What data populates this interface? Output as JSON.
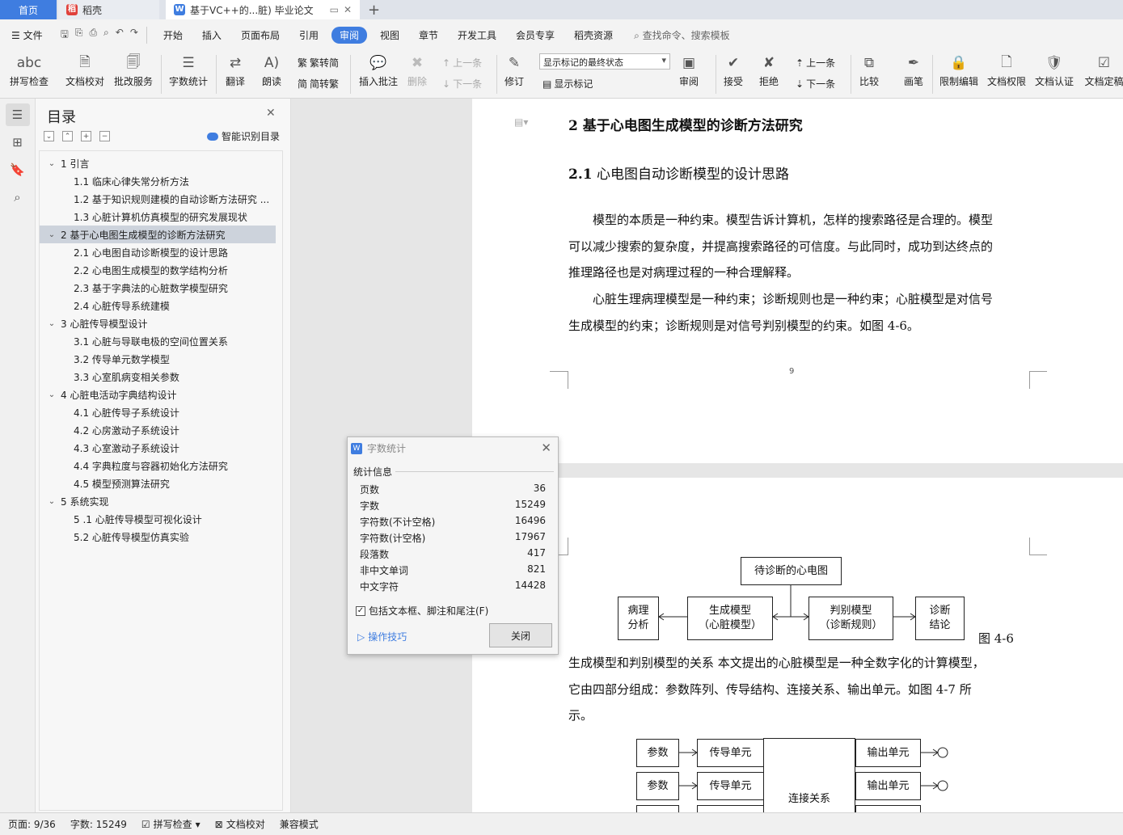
{
  "tabs": {
    "home": "首页",
    "docer": "稻壳",
    "document": "基于VC++的...脏) 毕业论文",
    "new_tab": "+"
  },
  "menu": {
    "file": "文件",
    "items": [
      "开始",
      "插入",
      "页面布局",
      "引用",
      "审阅",
      "视图",
      "章节",
      "开发工具",
      "会员专享",
      "稻壳资源"
    ],
    "active": "审阅",
    "search": "查找命令、搜索模板"
  },
  "ribbon": {
    "spellcheck": "拼写检查",
    "doc_proof": "文档校对",
    "proof_service": "批改服务",
    "word_count": "字数统计",
    "translate": "翻译",
    "read_aloud": "朗读",
    "to_simplified": "繁转简",
    "to_traditional": "简转繁",
    "insert_comment": "插入批注",
    "delete": "删除",
    "prev_comment": "上一条",
    "next_comment": "下一条",
    "revise": "修订",
    "markup_mode": "显示标记的最终状态",
    "show_markup": "显示标记",
    "review": "审阅",
    "accept": "接受",
    "reject": "拒绝",
    "prev_change": "上一条",
    "next_change": "下一条",
    "compare": "比较",
    "pen": "画笔",
    "restrict_edit": "限制编辑",
    "doc_permission": "文档权限",
    "doc_certify": "文档认证",
    "doc_finalize": "文档定稿"
  },
  "toc": {
    "title": "目录",
    "smart": "智能识别目录",
    "items": [
      {
        "level": 1,
        "text": "1 引言"
      },
      {
        "level": 2,
        "text": "1.1 临床心律失常分析方法"
      },
      {
        "level": 2,
        "text": "1.2 基于知识规则建模的自动诊断方法研究 ..."
      },
      {
        "level": 2,
        "text": "1.3 心脏计算机仿真模型的研究发展现状"
      },
      {
        "level": 1,
        "text": "2 基于心电图生成模型的诊断方法研究",
        "selected": true
      },
      {
        "level": 2,
        "text": "2.1 心电图自动诊断模型的设计思路"
      },
      {
        "level": 2,
        "text": "2.2 心电图生成模型的数学结构分析"
      },
      {
        "level": 2,
        "text": "2.3 基于字典法的心脏数学模型研究"
      },
      {
        "level": 2,
        "text": "2.4 心脏传导系统建模"
      },
      {
        "level": 1,
        "text": "3 心脏传导模型设计"
      },
      {
        "level": 2,
        "text": "3.1 心脏与导联电极的空间位置关系"
      },
      {
        "level": 2,
        "text": "3.2 传导单元数学模型"
      },
      {
        "level": 2,
        "text": "3.3 心室肌病变相关参数"
      },
      {
        "level": 1,
        "text": "4 心脏电活动字典结构设计"
      },
      {
        "level": 2,
        "text": "4.1 心脏传导子系统设计"
      },
      {
        "level": 2,
        "text": "4.2 心房激动子系统设计"
      },
      {
        "level": 2,
        "text": "4.3 心室激动子系统设计"
      },
      {
        "level": 2,
        "text": "4.4 字典粒度与容器初始化方法研究"
      },
      {
        "level": 2,
        "text": "4.5 模型预测算法研究"
      },
      {
        "level": 1,
        "text": "5 系统实现"
      },
      {
        "level": 2,
        "text": "5 .1 心脏传导模型可视化设计"
      },
      {
        "level": 2,
        "text": "5.2 心脏传导模型仿真实验"
      }
    ]
  },
  "document": {
    "heading2": "2 基于心电图生成模型的诊断方法研究",
    "heading3_num": "2.1",
    "heading3_text": "心电图自动诊断模型的设计思路",
    "para1_line1": "模型的本质是一种约束。模型告诉计算机，怎样的搜索路径是合理的。模型",
    "para1_line2": "可以减少搜索的复杂度，并提高搜索路径的可信度。与此同时，成功到达终点的",
    "para1_line3": "推理路径也是对病理过程的一种合理解释。",
    "para2_line1": "心脏生理病理模型是一种约束；诊断规则也是一种约束；心脏模型是对信号",
    "para2_line2": "生成模型的约束；诊断规则是对信号判别模型的约束。如图  4-6。",
    "page_number": "9",
    "fig46": {
      "top": "待诊断的心电图",
      "pathology_1": "病理",
      "pathology_2": "分析",
      "generate_1": "生成模型",
      "generate_2": "（心脏模型）",
      "discriminate_1": "判别模型",
      "discriminate_2": "（诊断规则）",
      "conclusion_1": "诊断",
      "conclusion_2": "结论",
      "caption": "图  4-6"
    },
    "para3_line1": "生成模型和判别模型的关系  本文提出的心脏模型是一种全数字化的计算模型，",
    "para3_line2": "它由四部分组成：参数阵列、传导结构、连接关系、输出单元。如图  4-7 所",
    "para3_line3": "示。",
    "fig47": {
      "param": "参数",
      "conduct": "传导单元",
      "connect": "连接关系",
      "output": "输出单元"
    }
  },
  "dialog": {
    "title": "字数统计",
    "section": "统计信息",
    "rows": [
      {
        "label": "页数",
        "value": "36"
      },
      {
        "label": "字数",
        "value": "15249"
      },
      {
        "label": "字符数(不计空格)",
        "value": "16496"
      },
      {
        "label": "字符数(计空格)",
        "value": "17967"
      },
      {
        "label": "段落数",
        "value": "417"
      },
      {
        "label": "非中文单词",
        "value": "821"
      },
      {
        "label": "中文字符",
        "value": "14428"
      }
    ],
    "include_label": "包括文本框、脚注和尾注(F)",
    "tips": "操作技巧",
    "close": "关闭"
  },
  "status": {
    "page": "页面: 9/36",
    "words": "字数: 15249",
    "spell": "拼写检查",
    "proof": "文档校对",
    "compat": "兼容模式"
  },
  "colors": {
    "accent": "#3f7de0"
  }
}
